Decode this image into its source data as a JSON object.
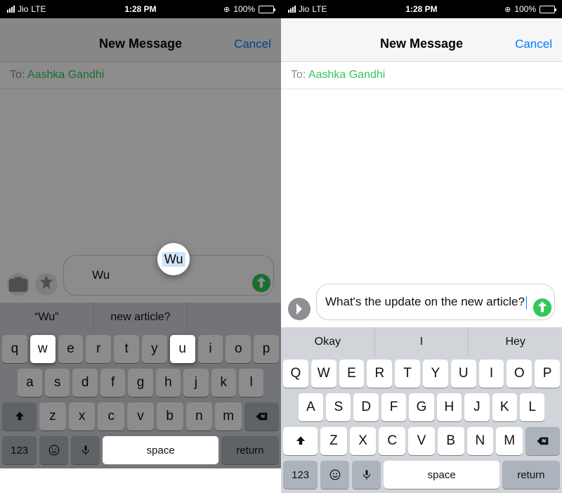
{
  "status": {
    "carrier": "Jio",
    "network": "LTE",
    "time": "1:28 PM",
    "battery_pct": "100%"
  },
  "nav": {
    "title": "New Message",
    "cancel": "Cancel"
  },
  "to": {
    "label": "To:",
    "name": "Aashka Gandhi"
  },
  "left": {
    "input_text": "Wu",
    "quicktype": [
      "“Wu”",
      "new article?",
      ""
    ]
  },
  "right": {
    "input_text": "What's the update on the new article?",
    "quicktype": [
      "Okay",
      "I",
      "Hey"
    ]
  },
  "keyboard": {
    "row1_upper": [
      "Q",
      "W",
      "E",
      "R",
      "T",
      "Y",
      "U",
      "I",
      "O",
      "P"
    ],
    "row1_lower": [
      "q",
      "w",
      "e",
      "r",
      "t",
      "y",
      "u",
      "i",
      "o",
      "p"
    ],
    "row2_upper": [
      "A",
      "S",
      "D",
      "F",
      "G",
      "H",
      "J",
      "K",
      "L"
    ],
    "row2_lower": [
      "a",
      "s",
      "d",
      "f",
      "g",
      "h",
      "j",
      "k",
      "l"
    ],
    "row3_upper": [
      "Z",
      "X",
      "C",
      "V",
      "B",
      "N",
      "M"
    ],
    "row3_lower": [
      "z",
      "x",
      "c",
      "v",
      "b",
      "n",
      "m"
    ],
    "n123": "123",
    "space": "space",
    "return": "return"
  }
}
